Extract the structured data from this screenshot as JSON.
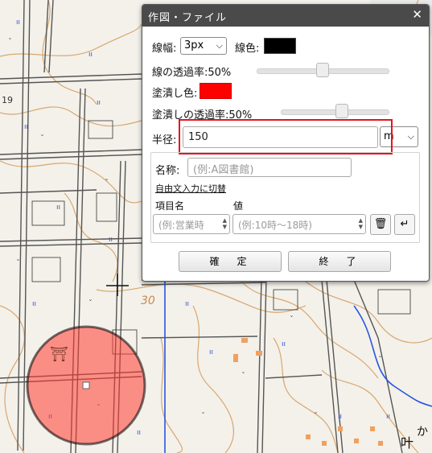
{
  "dialog": {
    "title": "作図・ファイル",
    "close_symbol": "✕",
    "line_width_label": "線幅:",
    "line_width_value": "3px",
    "line_color_label": "線色:",
    "line_color": "#000000",
    "line_opacity_label": "線の透過率:50%",
    "line_opacity": 0.5,
    "fill_color_label": "塗潰し色:",
    "fill_color": "#ff0000",
    "fill_opacity_label": "塗潰しの透過率:50%",
    "fill_opacity": 0.5,
    "radius_label": "半径:",
    "radius_value": "150",
    "radius_unit": "m",
    "name_label": "名称:",
    "name_placeholder": "(例:A図書館)",
    "free_text_link": "自由文入力に切替",
    "item_name_header": "項目名",
    "value_header": "値",
    "item_placeholder": "(例:営業時",
    "value_placeholder": "(例:10時〜18時)",
    "confirm_button": "確　定",
    "exit_button": "終　了"
  },
  "map": {
    "contour_label": "30",
    "place_chars": "叶",
    "place_chars2": "か",
    "circle_fill": "#ff3b30",
    "shrine_symbol": "⛩"
  }
}
